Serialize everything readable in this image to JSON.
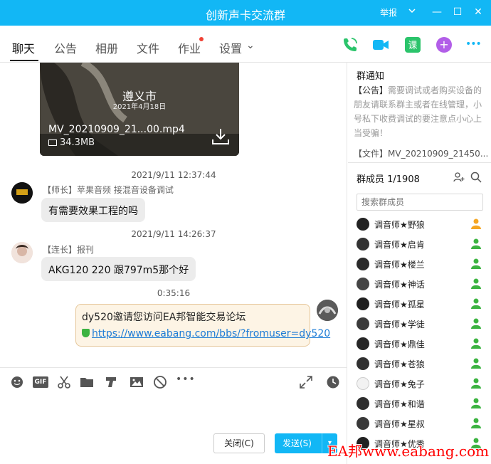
{
  "window": {
    "title": "创新声卡交流群",
    "report": "举报",
    "minimize": "—",
    "maximize": "☐",
    "close": "✕"
  },
  "tabs": [
    {
      "label": "聊天"
    },
    {
      "label": "公告"
    },
    {
      "label": "相册"
    },
    {
      "label": "文件"
    },
    {
      "label": "作业"
    },
    {
      "label": "设置"
    }
  ],
  "settings_chevron": "⌄",
  "toolbar": {
    "lesson": "课",
    "plus": "+",
    "more": "•••"
  },
  "video": {
    "city": "遵义市",
    "date": "2021年4月18日",
    "filename": "MV_20210909_21...00.mp4",
    "size": "34.3MB"
  },
  "messages": [
    {
      "time": "2021/9/11 12:37:44",
      "sender": "【师长】苹果音频 接混音设备调试",
      "text": "有需要效果工程的吗"
    },
    {
      "time": "2021/9/11 14:26:37",
      "sender": "【连长】报刊",
      "text": "AKG120 220 跟797m5那个好"
    },
    {
      "time": "0:35:16",
      "text": "dy520邀请您访问EA邦智能交易论坛",
      "link": "https://www.eabang.com/bbs/?fromuser=dy520"
    }
  ],
  "composer": {
    "gif": "GIF",
    "close_label": "关闭(C)",
    "send_label": "发送(S)",
    "send_arrow": "▾"
  },
  "sidebar": {
    "notice_title": "群通知",
    "notice_tag": "【公告】",
    "notice_text": "需要调试或者购买设备的朋友请联系群主或者在线管理，小号私下收费调试的要注意点小心上当受骗！",
    "file_line": "【文件】MV_20210909_21450...",
    "members_title": "群成员 1/1908",
    "search_placeholder": "搜索群成员",
    "members": [
      {
        "name": "调音师★野狼",
        "role_color": "#f5a623"
      },
      {
        "name": "调音师★启肯",
        "role_color": "#3cb341"
      },
      {
        "name": "调音师★楼兰",
        "role_color": "#3cb341"
      },
      {
        "name": "调音师★神话",
        "role_color": "#3cb341"
      },
      {
        "name": "调音师★孤星",
        "role_color": "#3cb341"
      },
      {
        "name": "调音师★学徒",
        "role_color": "#3cb341"
      },
      {
        "name": "调音师★鼎佳",
        "role_color": "#3cb341"
      },
      {
        "name": "调音师★苍狼",
        "role_color": "#3cb341"
      },
      {
        "name": "调音师★兔子",
        "role_color": "#3cb341"
      },
      {
        "name": "调音师★和谐",
        "role_color": "#3cb341"
      },
      {
        "name": "调音师★星叔",
        "role_color": "#3cb341"
      },
      {
        "name": "调音师★优秀",
        "role_color": "#3cb341"
      }
    ]
  },
  "watermark": "EA邦www.eabang.com"
}
